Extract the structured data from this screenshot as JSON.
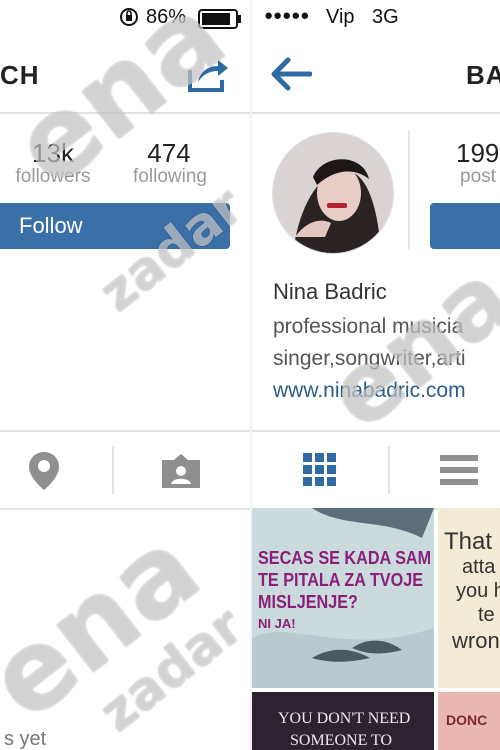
{
  "status_bar": {
    "battery_percent": "86%",
    "carrier_dots": "●●●●●",
    "carrier": "Vip",
    "network": "3G"
  },
  "left_screen": {
    "nav_title_partial": "CH",
    "stats": [
      {
        "count": "13k",
        "label": "followers"
      },
      {
        "count": "474",
        "label": "following"
      }
    ],
    "follow_label": "Follow",
    "bottom_text_partial": "s yet"
  },
  "right_screen": {
    "nav_title_partial": "BA",
    "stats": [
      {
        "count": "199",
        "label": "post"
      }
    ],
    "profile": {
      "name": "Nina Badric",
      "bio_line1": "professional musicia",
      "bio_line2": "singer,songwriter,arti",
      "website": "www.ninabadric.com"
    },
    "posts": [
      {
        "line1": "SECAS SE KADA SAM",
        "line2": "TE PITALA ZA TVOJE",
        "line3": "MISLJENJE?",
        "line4": "NI JA!"
      },
      {
        "line1": "That",
        "line2": "atta",
        "line3": "you h",
        "line4": "te",
        "line5": "wron"
      },
      {
        "line1": "YOU DON'T NEED",
        "line2": "SOMEONE TO"
      },
      {
        "line1": "DONC"
      }
    ]
  },
  "watermark": {
    "text1": "ena",
    "text2": "zadar"
  },
  "colors": {
    "accent": "#3a6fa7",
    "link": "#2b5d8f",
    "icon_gray": "#8f8f8f"
  }
}
